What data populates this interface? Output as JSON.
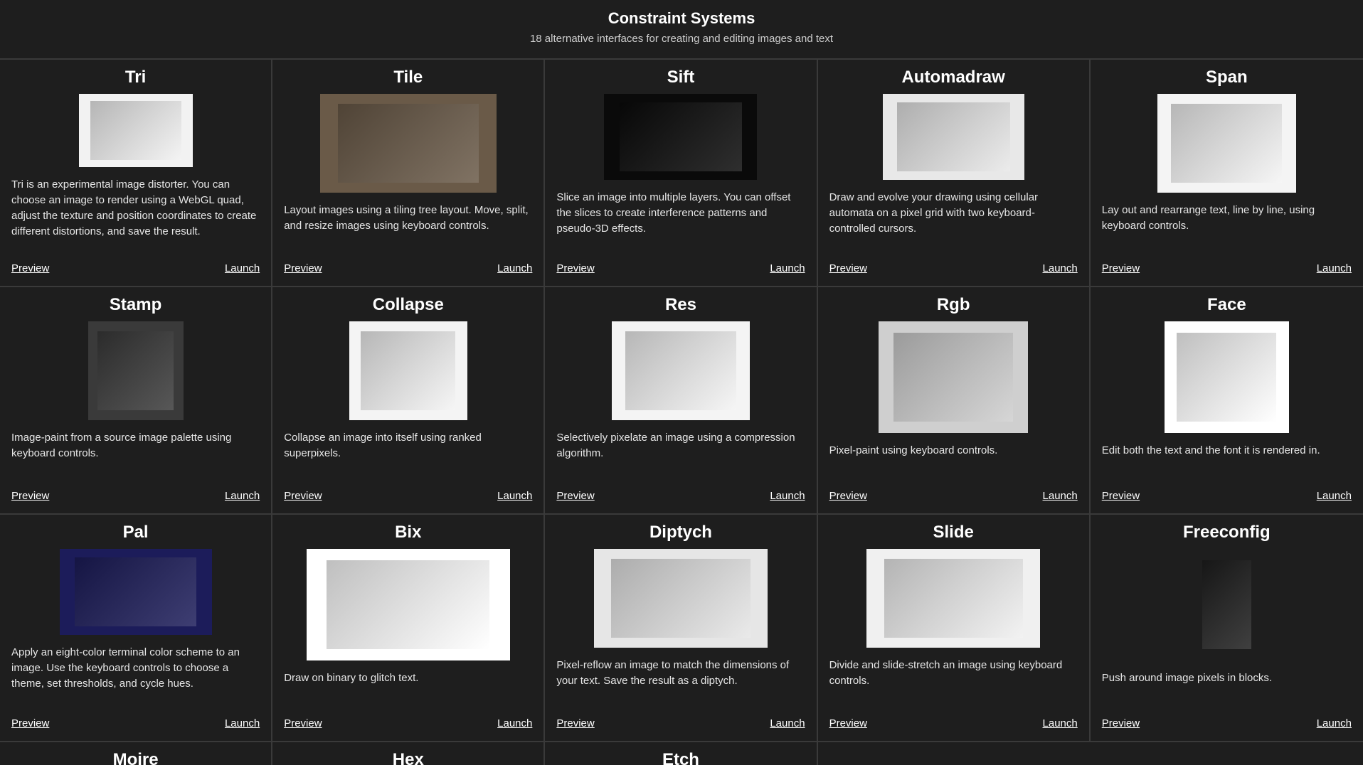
{
  "header": {
    "title": "Constraint Systems",
    "subtitle": "18 alternative interfaces for creating and editing images and text"
  },
  "link_labels": {
    "preview": "Preview",
    "launch": "Launch"
  },
  "cards": [
    {
      "title": "Tri",
      "desc": "Tri is an experimental image distorter. You can choose an image to render using a WebGL quad, adjust the texture and position coordinates to create different distortions, and save the result.",
      "thumb": "tri-thumbnail",
      "bg": "#f2f2f2"
    },
    {
      "title": "Tile",
      "desc": "Layout images using a tiling tree layout. Move, split, and resize images using keyboard controls.",
      "thumb": "tile-thumbnail",
      "bg": "#6a5a48"
    },
    {
      "title": "Sift",
      "desc": "Slice an image into multiple layers. You can offset the slices to create interference patterns and pseudo-3D effects.",
      "thumb": "sift-thumbnail",
      "bg": "#0a0a0a"
    },
    {
      "title": "Automadraw",
      "desc": "Draw and evolve your drawing using cellular automata on a pixel grid with two keyboard-controlled cursors.",
      "thumb": "automadraw-thumbnail",
      "bg": "#e8e8e8"
    },
    {
      "title": "Span",
      "desc": "Lay out and rearrange text, line by line, using keyboard controls.",
      "thumb": "span-thumbnail",
      "bg": "#f4f4f4"
    },
    {
      "title": "Stamp",
      "desc": "Image-paint from a source image palette using keyboard controls.",
      "thumb": "stamp-thumbnail",
      "bg": "#3a3a3a"
    },
    {
      "title": "Collapse",
      "desc": "Collapse an image into itself using ranked superpixels.",
      "thumb": "collapse-thumbnail",
      "bg": "#f4f4f4"
    },
    {
      "title": "Res",
      "desc": "Selectively pixelate an image using a compression algorithm.",
      "thumb": "res-thumbnail",
      "bg": "#f4f4f4"
    },
    {
      "title": "Rgb",
      "desc": "Pixel-paint using keyboard controls.",
      "thumb": "rgb-thumbnail",
      "bg": "#cfcfcf"
    },
    {
      "title": "Face",
      "desc": "Edit both the text and the font it is rendered in.",
      "thumb": "face-thumbnail",
      "bg": "#ffffff"
    },
    {
      "title": "Pal",
      "desc": "Apply an eight-color terminal color scheme to an image. Use the keyboard controls to choose a theme, set thresholds, and cycle hues.",
      "thumb": "pal-thumbnail",
      "bg": "#1c1c5a"
    },
    {
      "title": "Bix",
      "desc": "Draw on binary to glitch text.",
      "thumb": "bix-thumbnail",
      "bg": "#ffffff"
    },
    {
      "title": "Diptych",
      "desc": "Pixel-reflow an image to match the dimensions of your text. Save the result as a diptych.",
      "thumb": "diptych-thumbnail",
      "bg": "#e6e6e6"
    },
    {
      "title": "Slide",
      "desc": "Divide and slide-stretch an image using keyboard controls.",
      "thumb": "slide-thumbnail",
      "bg": "#f0f0f0"
    },
    {
      "title": "Freeconfig",
      "desc": "Push around image pixels in blocks.",
      "thumb": "freeconfig-thumbnail",
      "bg": "#1e1e1e"
    }
  ],
  "partial_cards": [
    "Moire",
    "Hex",
    "Etch"
  ],
  "colors": {
    "background": "#1e1e1e",
    "divider": "#3a3a3a",
    "text": "#e8e8e8"
  }
}
